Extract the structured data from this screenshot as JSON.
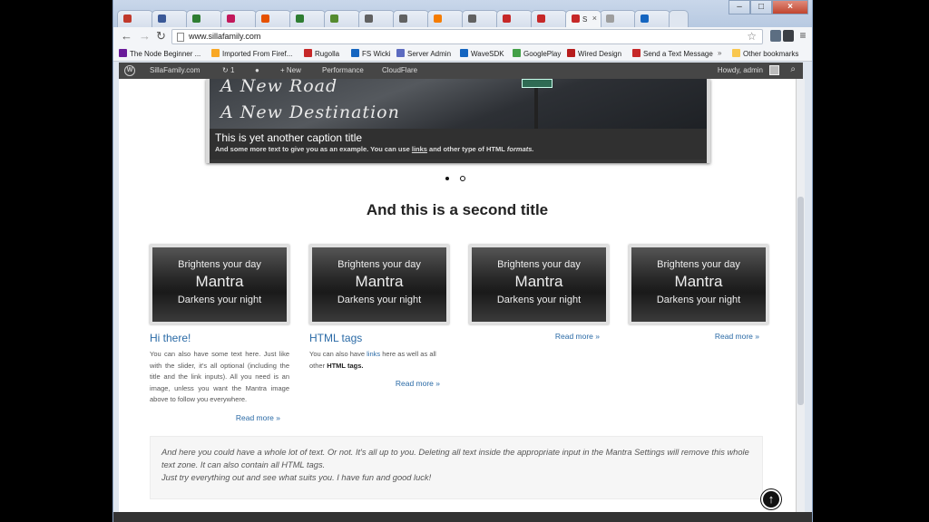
{
  "browser": {
    "tabs": [
      {
        "label": "",
        "color": "#c0392b"
      },
      {
        "label": "",
        "color": "#3b5998"
      },
      {
        "label": "",
        "color": "#2e7d32"
      },
      {
        "label": "",
        "color": "#c2185b"
      },
      {
        "label": "",
        "color": "#e65100"
      },
      {
        "label": "",
        "color": "#2e7d32"
      },
      {
        "label": "",
        "color": "#558b2f"
      },
      {
        "label": "",
        "color": "#616161"
      },
      {
        "label": "",
        "color": "#616161"
      },
      {
        "label": "",
        "color": "#f57c00"
      },
      {
        "label": "",
        "color": "#616161"
      },
      {
        "label": "",
        "color": "#c62828"
      },
      {
        "label": "",
        "color": "#c62828"
      },
      {
        "label": "S",
        "color": "#c62828"
      },
      {
        "label": "",
        "color": "#9e9e9e"
      },
      {
        "label": "",
        "color": "#1565c0"
      }
    ],
    "active_tab_index": 13,
    "tab_close_glyph": "×",
    "win_min": "–",
    "win_max": "□",
    "win_close": "×",
    "back_glyph": "←",
    "forward_glyph": "→",
    "reload_glyph": "↻",
    "url": "www.sillafamily.com",
    "star_glyph": "☆",
    "menu_glyph": "≡",
    "bookmarks": [
      {
        "label": "The Node Beginner ...",
        "color": "#6a1b9a"
      },
      {
        "label": "Imported From Firef...",
        "color": "#f9a825"
      },
      {
        "label": "Rugolla",
        "color": "#c62828"
      },
      {
        "label": "FS Wicki",
        "color": "#1565c0"
      },
      {
        "label": "Server Admin",
        "color": "#5c6bc0"
      },
      {
        "label": "WaveSDK",
        "color": "#1565c0"
      },
      {
        "label": "GooglePlay",
        "color": "#43a047"
      },
      {
        "label": "Wired Design",
        "color": "#b71c1c"
      },
      {
        "label": "Send a Text Message",
        "color": "#c62828"
      }
    ],
    "bookmarks_more": "»",
    "other_bookmarks": "Other bookmarks"
  },
  "adminbar": {
    "site": "SillaFamily.com",
    "updates": "1",
    "new": "New",
    "performance": "Performance",
    "cloudflare": "CloudFlare",
    "howdy": "Howdy, admin"
  },
  "slider": {
    "script_line1": "A New Road",
    "script_line2": "A New Destination",
    "caption_title": "This is yet another caption title",
    "caption_pre": "And some more text to give you as an example. You can use ",
    "caption_link": "links",
    "caption_mid": " and other type of ",
    "caption_bold": "HTML",
    "caption_end": " formats."
  },
  "second_title": "And this is a second title",
  "columns": [
    {
      "img_line1": "Brightens your day",
      "img_line2": "Mantra",
      "img_line3": "Darkens your night",
      "title": "Hi there!",
      "text": "You can also have some text here. Just like with the slider, it's all optional (including the title and the link inputs). All you need is an image, unless you want the Mantra image above to follow you everywhere.",
      "readmore": "Read more »"
    },
    {
      "img_line1": "Brightens your day",
      "img_line2": "Mantra",
      "img_line3": "Darkens your night",
      "title": "HTML tags",
      "text_pre": "You can also have ",
      "text_link": "links",
      "text_mid": " here as well as all other ",
      "text_bold": "HTML tags.",
      "readmore": "Read more »"
    },
    {
      "img_line1": "Brightens your day",
      "img_line2": "Mantra",
      "img_line3": "Darkens your night",
      "readmore": "Read more »"
    },
    {
      "img_line1": "Brightens your day",
      "img_line2": "Mantra",
      "img_line3": "Darkens your night",
      "readmore": "Read more »"
    }
  ],
  "textzone": {
    "line1": "And here you could have a whole lot of text. Or not. It's all up to you. Deleting all text inside the appropriate input in the Mantra Settings will remove this whole text zone. It can also contain all HTML tags.",
    "line2": "Just try everything out and see what suits you. I have fun and good luck!"
  },
  "scrolltop_glyph": "↑"
}
